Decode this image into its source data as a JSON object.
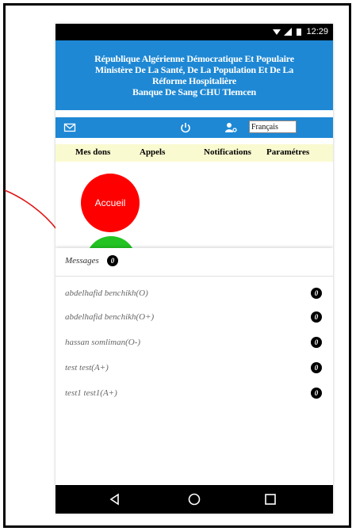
{
  "status_bar": {
    "time": "12:29"
  },
  "header": {
    "line1": "République Algérienne Démocratique Et Populaire",
    "line2": "Ministère De La Santé, De La Population Et De La",
    "line3": "Réforme Hospitalière",
    "line4": "Banque De Sang CHU Tlemcen"
  },
  "toolbar": {
    "language": "Français"
  },
  "tabs": [
    "Mes dons",
    "Appels",
    "Notifications",
    "Paramétres"
  ],
  "home_button": "Accueil",
  "messages": {
    "title": "Messages",
    "count": "0",
    "items": [
      {
        "name": "abdelhafid benchikh(O)",
        "count": "0"
      },
      {
        "name": "abdelhafid benchikh(O+)",
        "count": "0"
      },
      {
        "name": "hassan somliman(O-)",
        "count": "0"
      },
      {
        "name": "test test(A+)",
        "count": "0"
      },
      {
        "name": "test1 test1(A+)",
        "count": "0"
      }
    ]
  },
  "colors": {
    "header_blue": "#1e88d4",
    "tabs_bg": "#fafad0",
    "home_red": "#ff0000",
    "green": "#22c322",
    "annotation": "#e01010"
  }
}
